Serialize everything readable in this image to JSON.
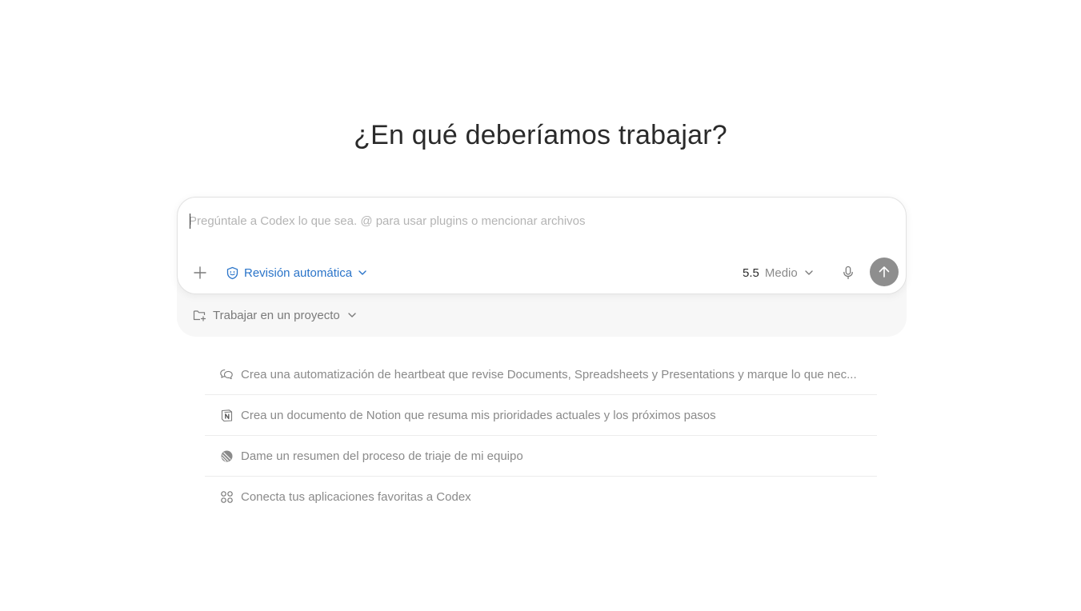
{
  "header": {
    "title": "¿En qué deberíamos trabajar?"
  },
  "composer": {
    "placeholder": "Pregúntale a Codex lo que sea. @ para usar plugins o mencionar archivos",
    "value": "",
    "review_label": "Revisión automática",
    "model_version": "5.5",
    "model_effort": "Medio"
  },
  "project": {
    "label": "Trabajar en un proyecto"
  },
  "suggestions": [
    {
      "icon": "chat-bubbles-icon",
      "text": "Crea una automatización de heartbeat que revise Documents, Spreadsheets y Presentations y marque lo que nec..."
    },
    {
      "icon": "notion-icon",
      "text": "Crea un documento de Notion que resuma mis prioridades actuales y los próximos pasos"
    },
    {
      "icon": "linear-icon",
      "text": "Dame un resumen del proceso de triaje de mi equipo"
    },
    {
      "icon": "apps-grid-icon",
      "text": "Conecta tus aplicaciones favoritas a Codex"
    }
  ],
  "colors": {
    "accent_blue": "#2a74c9",
    "send_button": "#8e8e8e",
    "muted_text": "#8a8a8a"
  }
}
